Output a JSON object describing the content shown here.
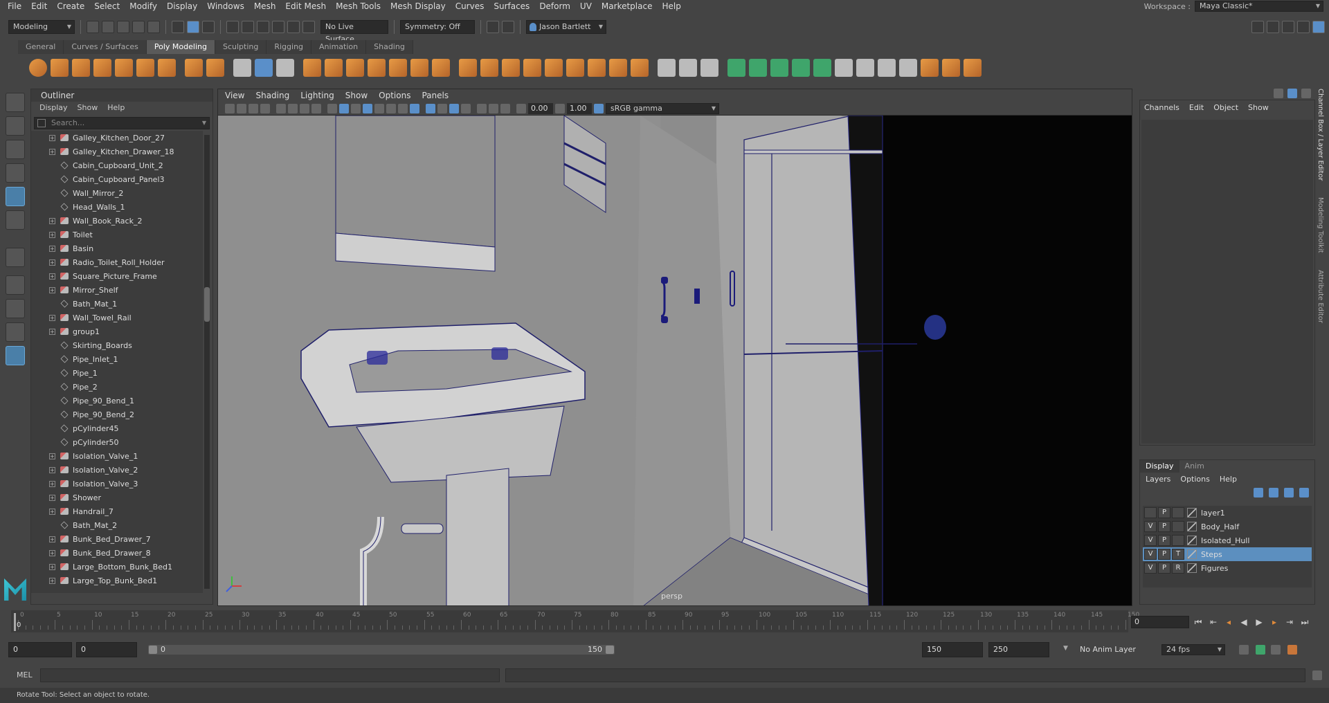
{
  "menubar": {
    "items": [
      "File",
      "Edit",
      "Create",
      "Select",
      "Modify",
      "Display",
      "Windows",
      "Mesh",
      "Edit Mesh",
      "Mesh Tools",
      "Mesh Display",
      "Curves",
      "Surfaces",
      "Deform",
      "UV",
      "Marketplace",
      "Help"
    ],
    "workspace_label": "Workspace :",
    "workspace_value": "Maya Classic*"
  },
  "statusline": {
    "mode": "Modeling",
    "live_surface": "No Live Surface",
    "symmetry": "Symmetry: Off",
    "user": "Jason Bartlett"
  },
  "shelf": {
    "tabs": [
      "General",
      "Curves / Surfaces",
      "Poly Modeling",
      "Sculpting",
      "Rigging",
      "Animation",
      "Shading"
    ],
    "active_tab": "Poly Modeling"
  },
  "outliner": {
    "title": "Outliner",
    "menus": [
      "Display",
      "Show",
      "Help"
    ],
    "search_placeholder": "Search...",
    "items": [
      {
        "name": "Galley_Kitchen_Door_27",
        "expandable": true,
        "type": "mesh"
      },
      {
        "name": "Galley_Kitchen_Drawer_18",
        "expandable": true,
        "type": "mesh"
      },
      {
        "name": "Cabin_Cupboard_Unit_2",
        "expandable": false,
        "type": "group"
      },
      {
        "name": "Cabin_Cupboard_Panel3",
        "expandable": false,
        "type": "group"
      },
      {
        "name": "Wall_Mirror_2",
        "expandable": false,
        "type": "group"
      },
      {
        "name": "Head_Walls_1",
        "expandable": false,
        "type": "group"
      },
      {
        "name": "Wall_Book_Rack_2",
        "expandable": true,
        "type": "mesh"
      },
      {
        "name": "Toilet",
        "expandable": true,
        "type": "mesh"
      },
      {
        "name": "Basin",
        "expandable": true,
        "type": "mesh"
      },
      {
        "name": "Radio_Toilet_Roll_Holder",
        "expandable": true,
        "type": "mesh"
      },
      {
        "name": "Square_Picture_Frame",
        "expandable": true,
        "type": "mesh"
      },
      {
        "name": "Mirror_Shelf",
        "expandable": true,
        "type": "mesh"
      },
      {
        "name": "Bath_Mat_1",
        "expandable": false,
        "type": "group"
      },
      {
        "name": "Wall_Towel_Rail",
        "expandable": true,
        "type": "mesh"
      },
      {
        "name": "group1",
        "expandable": true,
        "type": "mesh"
      },
      {
        "name": "Skirting_Boards",
        "expandable": false,
        "type": "group"
      },
      {
        "name": "Pipe_Inlet_1",
        "expandable": false,
        "type": "group"
      },
      {
        "name": "Pipe_1",
        "expandable": false,
        "type": "group"
      },
      {
        "name": "Pipe_2",
        "expandable": false,
        "type": "group"
      },
      {
        "name": "Pipe_90_Bend_1",
        "expandable": false,
        "type": "group"
      },
      {
        "name": "Pipe_90_Bend_2",
        "expandable": false,
        "type": "group"
      },
      {
        "name": "pCylinder45",
        "expandable": false,
        "type": "group"
      },
      {
        "name": "pCylinder50",
        "expandable": false,
        "type": "group"
      },
      {
        "name": "Isolation_Valve_1",
        "expandable": true,
        "type": "mesh"
      },
      {
        "name": "Isolation_Valve_2",
        "expandable": true,
        "type": "mesh"
      },
      {
        "name": "Isolation_Valve_3",
        "expandable": true,
        "type": "mesh"
      },
      {
        "name": "Shower",
        "expandable": true,
        "type": "mesh"
      },
      {
        "name": "Handrail_7",
        "expandable": true,
        "type": "mesh"
      },
      {
        "name": "Bath_Mat_2",
        "expandable": false,
        "type": "group"
      },
      {
        "name": "Bunk_Bed_Drawer_7",
        "expandable": true,
        "type": "mesh"
      },
      {
        "name": "Bunk_Bed_Drawer_8",
        "expandable": true,
        "type": "mesh"
      },
      {
        "name": "Large_Bottom_Bunk_Bed1",
        "expandable": true,
        "type": "mesh"
      },
      {
        "name": "Large_Top_Bunk_Bed1",
        "expandable": true,
        "type": "mesh"
      }
    ]
  },
  "viewport": {
    "menus": [
      "View",
      "Shading",
      "Lighting",
      "Show",
      "Options",
      "Panels"
    ],
    "exposure": "0.00",
    "gamma": "1.00",
    "color_space": "sRGB gamma",
    "camera_label": "persp"
  },
  "channelbox": {
    "menus": [
      "Channels",
      "Edit",
      "Object",
      "Show"
    ],
    "side_tabs": [
      "Channel Box / Layer Editor",
      "Modeling Toolkit",
      "Attribute Editor"
    ]
  },
  "layereditor": {
    "tabs": [
      "Display",
      "Anim"
    ],
    "active_tab": "Display",
    "menus": [
      "Layers",
      "Options",
      "Help"
    ],
    "layers": [
      {
        "v": "",
        "p": "P",
        "r": "",
        "name": "layer1",
        "selected": false
      },
      {
        "v": "V",
        "p": "P",
        "r": "",
        "name": "Body_Half",
        "selected": false
      },
      {
        "v": "V",
        "p": "P",
        "r": "",
        "name": "Isolated_Hull",
        "selected": false
      },
      {
        "v": "V",
        "p": "P",
        "r": "T",
        "name": "Steps",
        "selected": true
      },
      {
        "v": "V",
        "p": "P",
        "r": "R",
        "name": "Figures",
        "selected": false
      }
    ]
  },
  "timeslider": {
    "tick_labels": [
      "0",
      "5",
      "10",
      "15",
      "20",
      "25",
      "30",
      "35",
      "40",
      "45",
      "50",
      "55",
      "60",
      "65",
      "70",
      "75",
      "80",
      "85",
      "90",
      "95",
      "100",
      "105",
      "110",
      "115",
      "120",
      "125",
      "130",
      "135",
      "140",
      "145",
      "150"
    ],
    "current_frame": "0",
    "current_frame_display": "0"
  },
  "rangeslider": {
    "start": "0",
    "anim_start": "0",
    "range_start": "0",
    "range_end": "150",
    "playback_end": "150",
    "anim_end": "250",
    "anim_layer": "No Anim Layer",
    "fps": "24 fps"
  },
  "commandline": {
    "label": "MEL"
  },
  "helpline": {
    "text": "Rotate Tool: Select an object to rotate."
  }
}
